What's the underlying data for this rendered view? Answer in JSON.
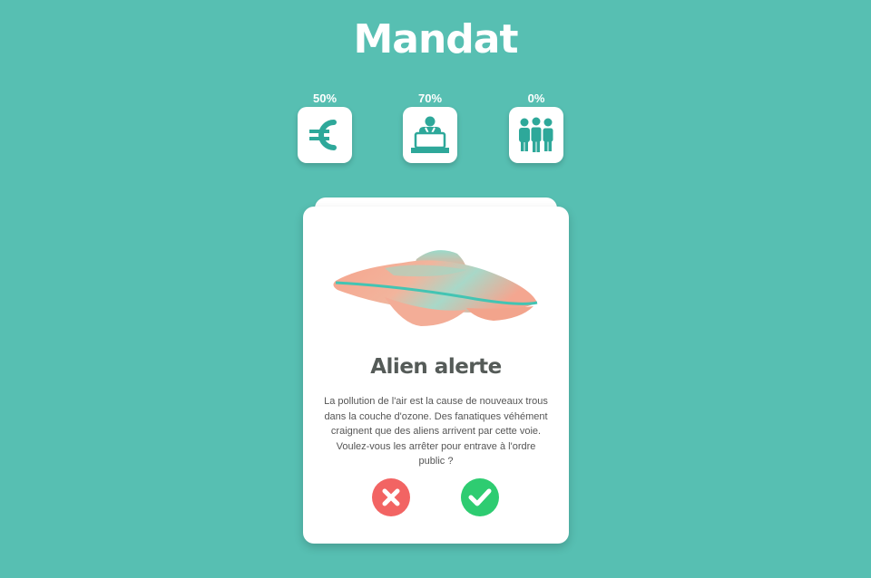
{
  "app": {
    "title": "Mandat"
  },
  "gauges": [
    {
      "label": "50%",
      "icon": "euro-icon"
    },
    {
      "label": "70%",
      "icon": "podium-speaker-icon"
    },
    {
      "label": "0%",
      "icon": "people-group-icon"
    }
  ],
  "card": {
    "image": "ufo-image",
    "title": "Alien alerte",
    "text": "La pollution de l'air est la cause de nouveaux trous dans la couche d'ozone. Des fanatiques véhément craignent que des aliens arrivent par cette voie. Voulez-vous les arrêter pour entrave à l'ordre public ?"
  },
  "colors": {
    "background": "#57bfb2",
    "accent": "#2ea89a",
    "reject": "#f26463",
    "accept": "#2ecc71"
  }
}
